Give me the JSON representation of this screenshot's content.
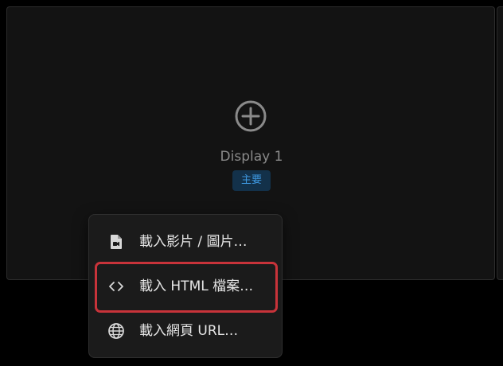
{
  "display": {
    "name": "Display 1",
    "badge": "主要"
  },
  "menu": {
    "items": [
      {
        "label": "載入影片 / 圖片…",
        "icon": "video-file-icon"
      },
      {
        "label": "載入 HTML 檔案…",
        "icon": "code-brackets-icon"
      },
      {
        "label": "載入網頁 URL…",
        "icon": "globe-icon"
      }
    ]
  },
  "colors": {
    "background": "#000000",
    "card": "#131313",
    "menu": "#1b1b1b",
    "badge_bg": "#13314a",
    "badge_text": "#3e98e0",
    "highlight": "#c8333a"
  }
}
